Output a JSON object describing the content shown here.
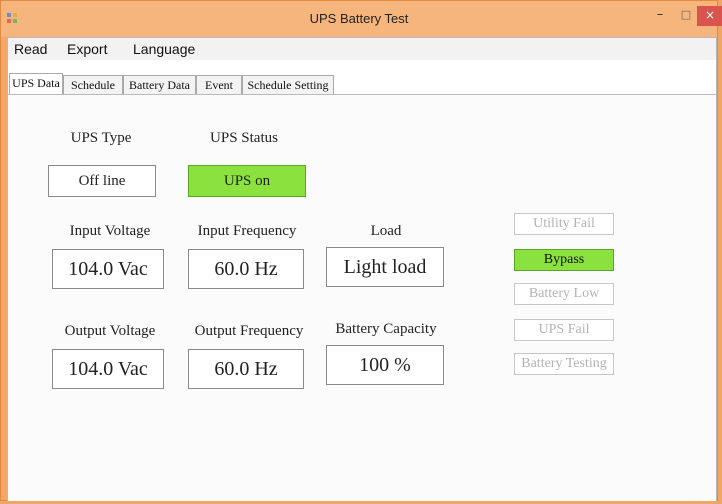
{
  "window": {
    "title": "UPS Battery Test",
    "icon": "app-icon",
    "controls": {
      "minimize": "–",
      "maximize": "□",
      "close": "×"
    }
  },
  "menu": [
    "Read",
    "Export",
    "Language"
  ],
  "tabs": [
    "UPS Data",
    "Schedule",
    "Battery Data",
    "Event",
    "Schedule Setting"
  ],
  "ups_data": {
    "ups_type": {
      "label": "UPS Type",
      "value": "Off line"
    },
    "ups_status": {
      "label": "UPS Status",
      "value": "UPS on"
    },
    "input_voltage": {
      "label": "Input Voltage",
      "value": "104.0 Vac"
    },
    "input_frequency": {
      "label": "Input Frequency",
      "value": "60.0 Hz"
    },
    "load": {
      "label": "Load",
      "value": "Light load"
    },
    "output_voltage": {
      "label": "Output Voltage",
      "value": "104.0 Vac"
    },
    "output_frequency": {
      "label": "Output Frequency",
      "value": "60.0 Hz"
    },
    "battery_capacity": {
      "label": "Battery Capacity",
      "value": "100 %"
    }
  },
  "indicators": [
    {
      "label": "Utility Fail",
      "active": false
    },
    {
      "label": "Bypass",
      "active": true
    },
    {
      "label": "Battery Low",
      "active": false
    },
    {
      "label": "UPS Fail",
      "active": false
    },
    {
      "label": "Battery Testing",
      "active": false
    }
  ],
  "colors": {
    "status_active": "#8be23e",
    "title_bar": "#f6b57c",
    "close_button": "#d9534f"
  }
}
